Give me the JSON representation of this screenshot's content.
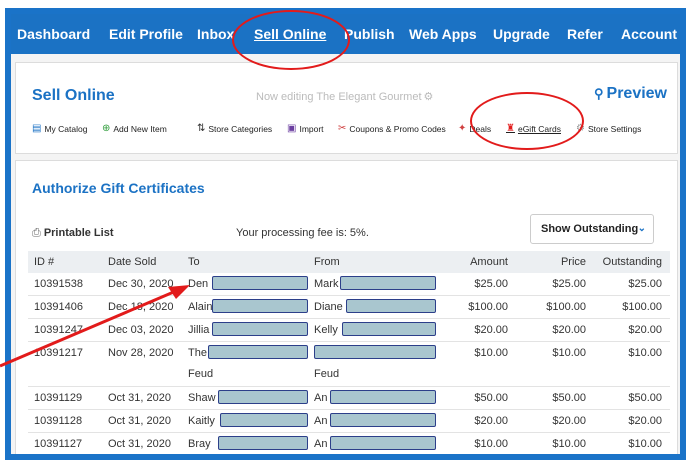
{
  "nav": {
    "items": [
      "Dashboard",
      "Edit Profile",
      "Inbox",
      "Sell Online",
      "Publish",
      "Web Apps",
      "Upgrade",
      "Refer",
      "Account"
    ],
    "active": "Sell Online"
  },
  "header": {
    "title": "Sell Online",
    "editing": "Now editing The Elegant Gourmet",
    "preview": "Preview"
  },
  "toolbar": {
    "items": [
      {
        "label": "My Catalog",
        "icon": "catalog-icon"
      },
      {
        "label": "Add New Item",
        "icon": "add-icon"
      },
      {
        "label": "Store Categories",
        "icon": "categories-icon"
      },
      {
        "label": "Import",
        "icon": "import-icon"
      },
      {
        "label": "Coupons & Promo Codes",
        "icon": "coupon-icon"
      },
      {
        "label": "Deals",
        "icon": "deals-icon"
      },
      {
        "label": "eGift Cards",
        "icon": "gift-icon"
      },
      {
        "label": "Store Settings",
        "icon": "gear-icon"
      }
    ]
  },
  "section": {
    "title": "Authorize Gift Certificates",
    "printable": "Printable List",
    "fee": "Your processing fee is: 5%.",
    "filter": "Show Outstanding"
  },
  "table": {
    "headers": [
      "ID #",
      "Date Sold",
      "To",
      "From",
      "Amount",
      "Price",
      "Outstanding"
    ],
    "rows": [
      {
        "id": "10391538",
        "date": "Dec 30, 2020",
        "to": "Den",
        "from": "Mark",
        "amount": "$25.00",
        "price": "$25.00",
        "outstanding": "$25.00"
      },
      {
        "id": "10391406",
        "date": "Dec 18, 2020",
        "to": "Alain",
        "from": "Diane",
        "amount": "$100.00",
        "price": "$100.00",
        "outstanding": "$100.00"
      },
      {
        "id": "10391247",
        "date": "Dec 03, 2020",
        "to": "Jillia",
        "from": "Kelly",
        "amount": "$20.00",
        "price": "$20.00",
        "outstanding": "$20.00"
      },
      {
        "id": "10391217",
        "date": "Nov 28, 2020",
        "to": "The",
        "to2": "Feud",
        "from": "",
        "from2": "Feud",
        "amount": "$10.00",
        "price": "$10.00",
        "outstanding": "$10.00"
      },
      {
        "id": "10391129",
        "date": "Oct 31, 2020",
        "to": "Shaw",
        "from": "An",
        "amount": "$50.00",
        "price": "$50.00",
        "outstanding": "$50.00"
      },
      {
        "id": "10391128",
        "date": "Oct 31, 2020",
        "to": "Kaitly",
        "from": "An",
        "amount": "$20.00",
        "price": "$20.00",
        "outstanding": "$20.00"
      },
      {
        "id": "10391127",
        "date": "Oct 31, 2020",
        "to": "Bray",
        "from": "An",
        "amount": "$10.00",
        "price": "$10.00",
        "outstanding": "$10.00"
      }
    ]
  },
  "annotation_color": "#e21b1b"
}
